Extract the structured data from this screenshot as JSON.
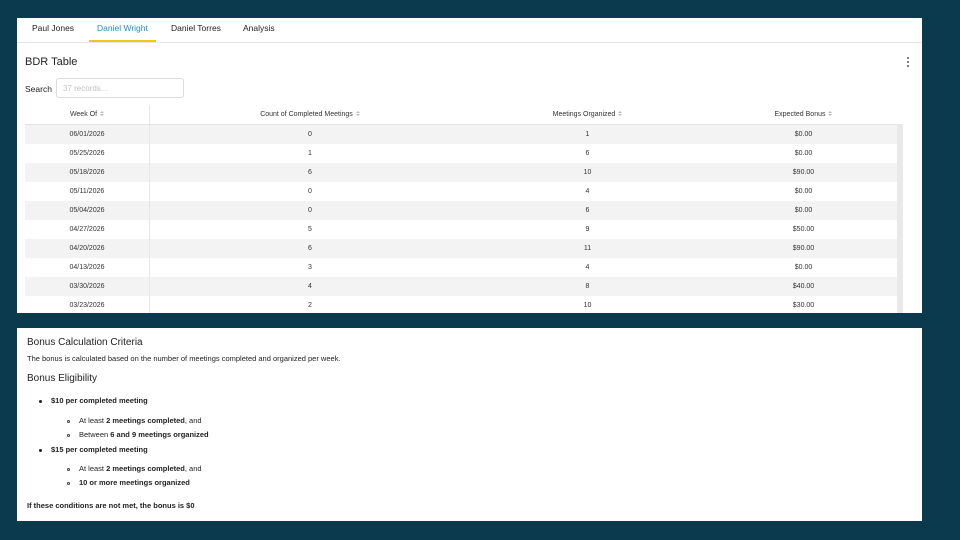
{
  "tabs": [
    {
      "label": "Paul Jones",
      "active": false
    },
    {
      "label": "Daniel Wright",
      "active": true
    },
    {
      "label": "Daniel Torres",
      "active": false
    },
    {
      "label": "Analysis",
      "active": false
    }
  ],
  "colors": {
    "background": "#0b3a4f",
    "active_tab": "#1a8fc6",
    "tab_indicator": "#f2c617"
  },
  "table": {
    "title": "BDR Table",
    "search_label": "Search",
    "search_placeholder": "37 records...",
    "columns": [
      "Week Of",
      "Count of Completed Meetings",
      "Meetings Organized",
      "Expected Bonus"
    ],
    "rows": [
      [
        "06/01/2026",
        "0",
        "1",
        "$0.00"
      ],
      [
        "05/25/2026",
        "1",
        "6",
        "$0.00"
      ],
      [
        "05/18/2026",
        "6",
        "10",
        "$90.00"
      ],
      [
        "05/11/2026",
        "0",
        "4",
        "$0.00"
      ],
      [
        "05/04/2026",
        "0",
        "6",
        "$0.00"
      ],
      [
        "04/27/2026",
        "5",
        "9",
        "$50.00"
      ],
      [
        "04/20/2026",
        "6",
        "11",
        "$90.00"
      ],
      [
        "04/13/2026",
        "3",
        "4",
        "$0.00"
      ],
      [
        "03/30/2026",
        "4",
        "8",
        "$40.00"
      ],
      [
        "03/23/2026",
        "2",
        "10",
        "$30.00"
      ]
    ]
  },
  "bonus": {
    "title": "Bonus Calculation Criteria",
    "description": "The bonus is calculated based on the number of meetings completed and organized per week.",
    "eligibility_title": "Bonus Eligibility",
    "tier1": {
      "heading": "$10 per completed meeting",
      "c1_prefix": "At least ",
      "c1_bold": "2 meetings completed",
      "c1_suffix": ", and",
      "c2_prefix": "Between ",
      "c2_bold": "6 and 9 meetings organized"
    },
    "tier2": {
      "heading": "$15 per completed meeting",
      "c1_prefix": "At least ",
      "c1_bold": "2 meetings completed",
      "c1_suffix": ", and",
      "c2_bold": "10 or more meetings organized"
    },
    "footer": "If these conditions are not met, the bonus is $0"
  }
}
